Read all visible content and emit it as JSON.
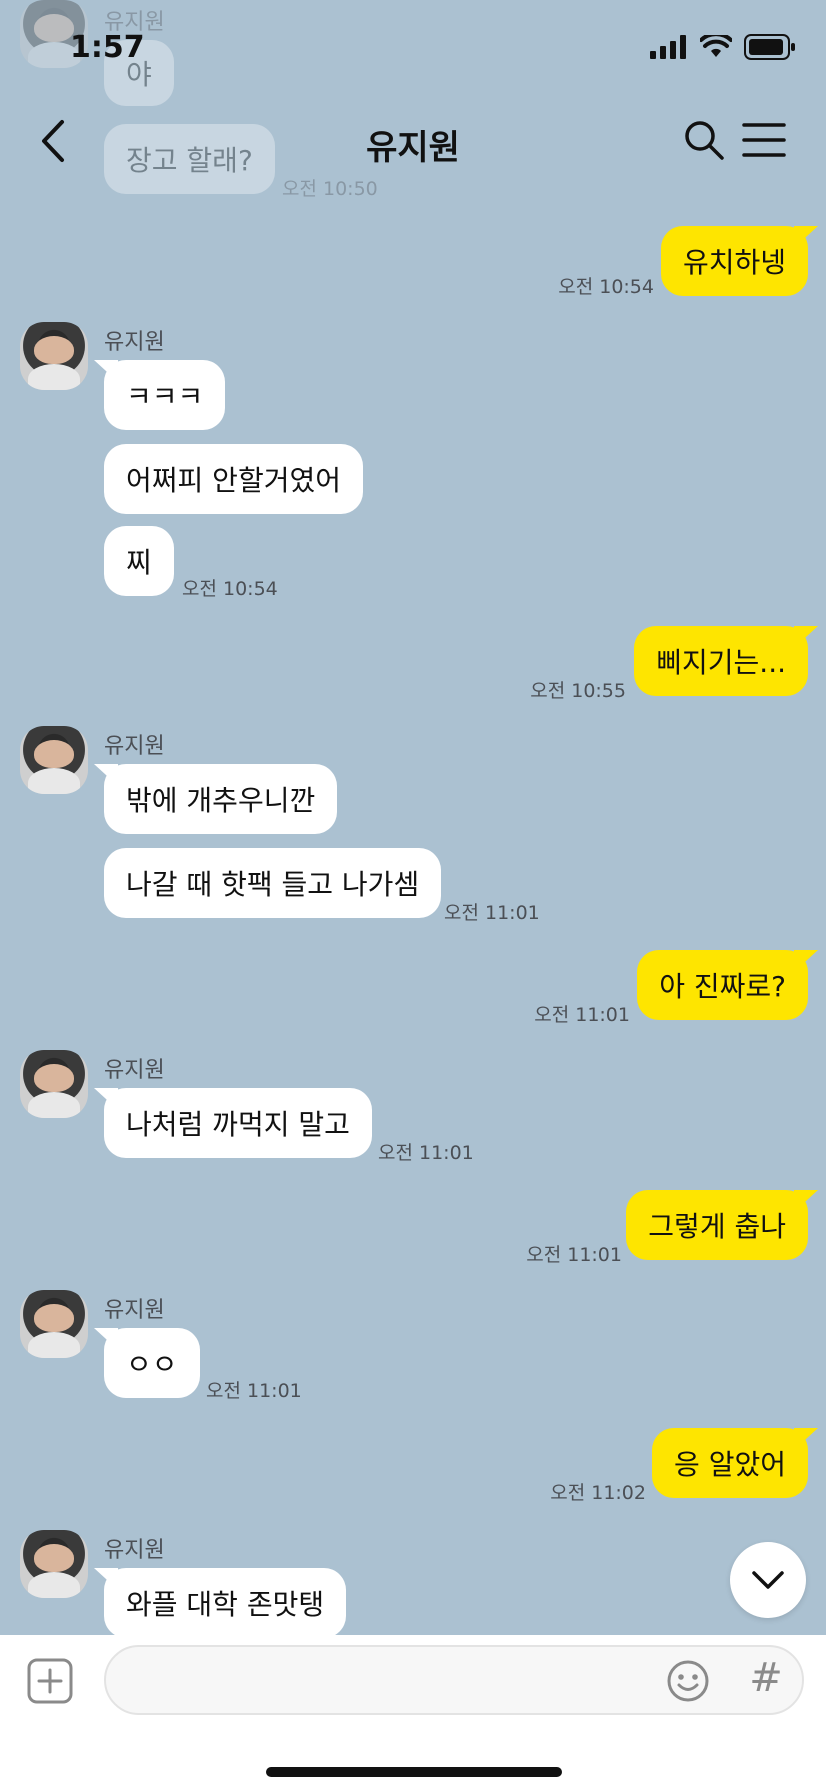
{
  "status_bar": {
    "time": "1:57"
  },
  "header": {
    "title": "유지원"
  },
  "faded_messages": [
    {
      "sender": "유지원",
      "text": "야"
    },
    {
      "text": "장고 할래?"
    },
    {
      "time": "오전 10:50"
    }
  ],
  "messages": [
    {
      "dir": "out",
      "text": "유치하넹",
      "time": "오전 10:54"
    },
    {
      "dir": "in",
      "sender": "유지원",
      "texts": [
        "ㅋㅋㅋ",
        "어쩌피 안할거였어",
        "찌"
      ],
      "time": "오전 10:54"
    },
    {
      "dir": "out",
      "text": "삐지기는...",
      "time": "오전 10:55"
    },
    {
      "dir": "in",
      "sender": "유지원",
      "texts": [
        "밖에 개추우니깐",
        "나갈 때 핫팩 들고 나가셈"
      ],
      "time": "오전 11:01"
    },
    {
      "dir": "out",
      "text": "아 진짜로?",
      "time": "오전 11:01"
    },
    {
      "dir": "in",
      "sender": "유지원",
      "texts": [
        "나처럼 까먹지 말고"
      ],
      "time": "오전 11:01"
    },
    {
      "dir": "out",
      "text": "그렇게 춥나",
      "time": "오전 11:01"
    },
    {
      "dir": "in",
      "sender": "유지원",
      "texts": [
        "ㅇㅇ"
      ],
      "time": "오전 11:01"
    },
    {
      "dir": "out",
      "text": "응 알았어",
      "time": "오전 11:02"
    },
    {
      "dir": "in",
      "sender": "유지원",
      "texts": [
        "와플 대학 존맛탱"
      ]
    }
  ],
  "input": {
    "value": "",
    "placeholder": ""
  },
  "icons": {
    "back": "back-arrow-icon",
    "search": "search-icon",
    "menu": "hamburger-menu-icon",
    "attach": "plus-square-icon",
    "emoji": "smiley-icon",
    "hash": "#",
    "scroll": "chevron-down-icon"
  },
  "colors": {
    "background": "#abc1d1",
    "outgoing_bubble": "#fee500",
    "incoming_bubble": "#ffffff"
  }
}
